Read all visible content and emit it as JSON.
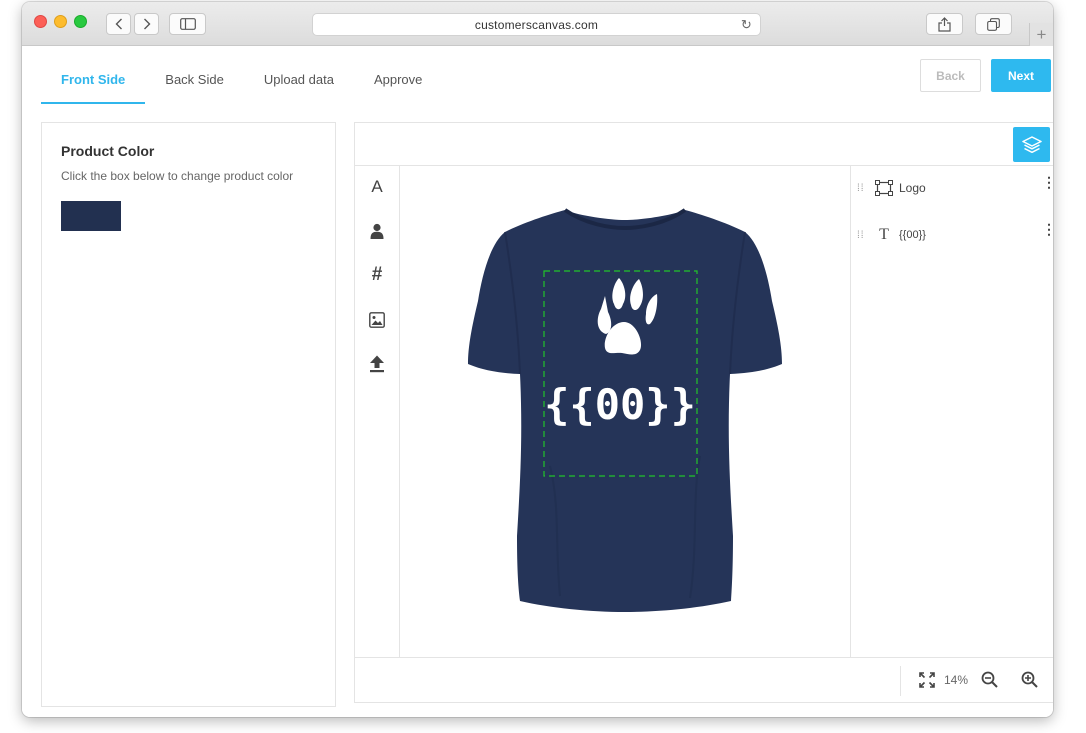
{
  "browser": {
    "url": "customerscanvas.com",
    "new_tab_label": "+"
  },
  "tabs": [
    {
      "label": "Front Side",
      "active": true
    },
    {
      "label": "Back Side",
      "active": false
    },
    {
      "label": "Upload data",
      "active": false
    },
    {
      "label": "Approve",
      "active": false
    }
  ],
  "nav": {
    "back_label": "Back",
    "next_label": "Next"
  },
  "product_color": {
    "title": "Product Color",
    "subtitle": "Click the box below to change product color",
    "swatch_color": "#223050"
  },
  "tools": [
    "text-icon",
    "clipart-icon",
    "hashtag-icon",
    "image-icon",
    "upload-icon"
  ],
  "tool_labels": {
    "text": "A",
    "hashtag": "#"
  },
  "canvas": {
    "shirt_color": "#253458",
    "design_text": "{{00}}"
  },
  "layers": [
    {
      "name": "Logo",
      "type": "image"
    },
    {
      "name": "{{00}}",
      "type": "text"
    }
  ],
  "layer_text_glyph": "T",
  "zoom": {
    "level": "14%"
  },
  "colors": {
    "accent": "#2eb9ef",
    "safety_area": "#22c42a"
  }
}
